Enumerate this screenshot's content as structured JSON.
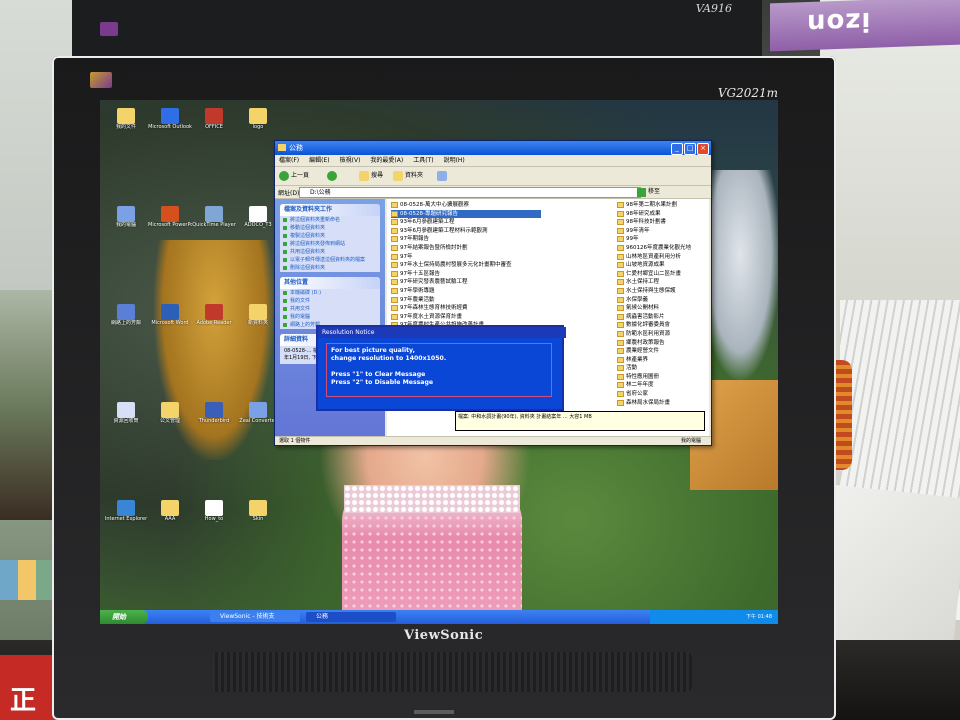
{
  "background": {
    "back_monitor_model": "VA916",
    "box_text": "izon",
    "desk_note_text": "正"
  },
  "monitor": {
    "model": "VG2021m",
    "brand": "ViewSonic"
  },
  "desktop_icons": [
    {
      "label": "我的文件",
      "color": "#f4d36a"
    },
    {
      "label": "我的電腦",
      "color": "#7aa1e6"
    },
    {
      "label": "網路上的芳鄰",
      "color": "#5a7fd6"
    },
    {
      "label": "資源回收筒",
      "color": "#d6dff7"
    },
    {
      "label": "Internet Explorer",
      "color": "#3a86d6"
    },
    {
      "label": "Microsoft Outlook",
      "color": "#2f6ee6"
    },
    {
      "label": "Microsoft PowerPoint",
      "color": "#d6501e"
    },
    {
      "label": "Microsoft Word",
      "color": "#2b5fb8"
    },
    {
      "label": "公文管理",
      "color": "#f4d36a"
    },
    {
      "label": "AAA",
      "color": "#f4d36a"
    },
    {
      "label": "OFFICE",
      "color": "#c0392b"
    },
    {
      "label": "QuickTime Player",
      "color": "#7fa7d6"
    },
    {
      "label": "Adobe Reader",
      "color": "#c0392b"
    },
    {
      "label": "Thunderbird",
      "color": "#3a5fb8"
    },
    {
      "label": "How_to",
      "color": "#ffffff"
    },
    {
      "label": "logo",
      "color": "#f4d36a"
    },
    {
      "label": "ADDCO_T3",
      "color": "#ffffff"
    },
    {
      "label": "新資料夾",
      "color": "#f4d36a"
    },
    {
      "label": "Zeal Converter",
      "color": "#7aa1e6"
    },
    {
      "label": "Skin",
      "color": "#f4d36a"
    }
  ],
  "explorer": {
    "title": "公務",
    "menu": [
      "檔案(F)",
      "編輯(E)",
      "檢視(V)",
      "我的最愛(A)",
      "工具(T)",
      "說明(H)"
    ],
    "toolbar": {
      "back": "上一頁",
      "search": "搜尋",
      "folders": "資料夾"
    },
    "address_label": "網址(D)",
    "address_value": "D:\\公務",
    "go_label": "移至",
    "task_pane": {
      "file_tasks_title": "檔案及資料夾工作",
      "file_tasks": [
        "將這個資料夾重新命名",
        "移動這個資料夾",
        "複製這個資料夾",
        "將這個資料夾發佈到網站",
        "共用這個資料夾",
        "以電子郵件傳送這個資料夾的檔案",
        "刪除這個資料夾"
      ],
      "other_places_title": "其他位置",
      "other_places": [
        "本機磁碟 (D:)",
        "我的文件",
        "共用文件",
        "我的電腦",
        "網路上的芳鄰"
      ],
      "details_title": "詳細資料",
      "details_text": "08-0528-... 檔案資料夾 修改日期: 2009年1月19日, 下午..."
    },
    "files_col1": [
      "08-0528-萬大中心擴展觀察",
      "08-0528-專題研究報告",
      "93年6月參觀建築工程",
      "93年6月參觀建築工程材料示範觀測",
      "97年期報告",
      "97年結案報告暨所檢討計劃",
      "97年",
      "97年水土保持局農村發展多元化計畫期中審查",
      "97年十五區報告",
      "97年研究發表農藝試驗工程",
      "97年學術專題",
      "97年農業活動",
      "97年森林生態育林技術經費",
      "97年度水土資源保育計畫",
      "97年度農村生產公共設施改善計畫"
    ],
    "files_col2": [
      "98年第二期水果計劃",
      "98年研究成果",
      "98年科技計劃書",
      "99年清年",
      "99年",
      "960126年度農業化觀光地",
      "山林地區資產利用分析",
      "山坡地資源成果",
      "仁愛村鄉宜山二區計畫",
      "水土保持工程",
      "水土保持與生態保護",
      "水保學義",
      "氣候公開材料",
      "病蟲害活動影片",
      "數據化評審委員會",
      "防範水區利用資源",
      "鄉農村政策報告",
      "農業經營文件",
      "林產業界",
      "活動",
      "特性應用圖冊",
      "林二年年度",
      "省府公家",
      "森林局水保局計畫"
    ],
    "selected_index": 1,
    "tooltip": "檔案: 中和水調計畫(90年), 資料夾 計畫結案年 ... 大容1 MB",
    "status_left": "選取 1 個物件",
    "status_right": "我的電腦"
  },
  "osd": {
    "title": "Resolution Notice",
    "line1": "For best picture quality,",
    "line2": "change resolution to 1400x1050.",
    "line3": "Press \"1\" to Clear Message",
    "line4": "Press \"2\" to Disable Message"
  },
  "taskbar": {
    "start": "開始",
    "items": [
      "ViewSonic - 技術支",
      "公務"
    ],
    "clock": "下午 01:48"
  }
}
